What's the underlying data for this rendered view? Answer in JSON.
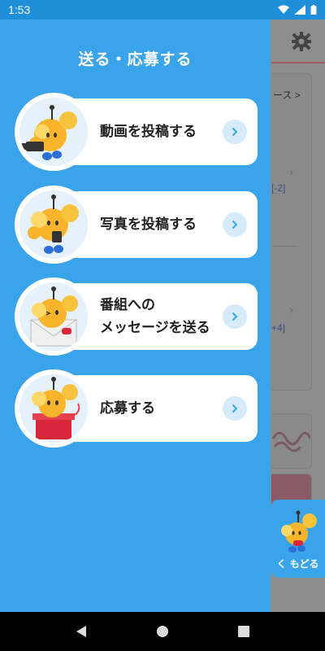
{
  "status": {
    "time": "1:53"
  },
  "drawer": {
    "title": "送る・応募する",
    "items": [
      {
        "label": "動画を投稿する",
        "icon": "mascot-video-camera-icon"
      },
      {
        "label": "写真を投稿する",
        "icon": "mascot-camera-icon"
      },
      {
        "label_line1": "番組への",
        "label_line2": "メッセージを送る",
        "icon": "mascot-envelope-icon"
      },
      {
        "label": "応募する",
        "icon": "mascot-gift-box-icon"
      }
    ]
  },
  "background": {
    "text_top": "ース >",
    "link1": "[-2]",
    "link2": "+4]"
  },
  "back_tab": {
    "label": "く もどる"
  },
  "colors": {
    "drawer_bg": "#3aa4ea",
    "status_bar": "#1f8fd9",
    "card_bg": "#ffffff",
    "arrow_bg": "#d6ebfa",
    "arrow_fg": "#3aa4ea"
  }
}
